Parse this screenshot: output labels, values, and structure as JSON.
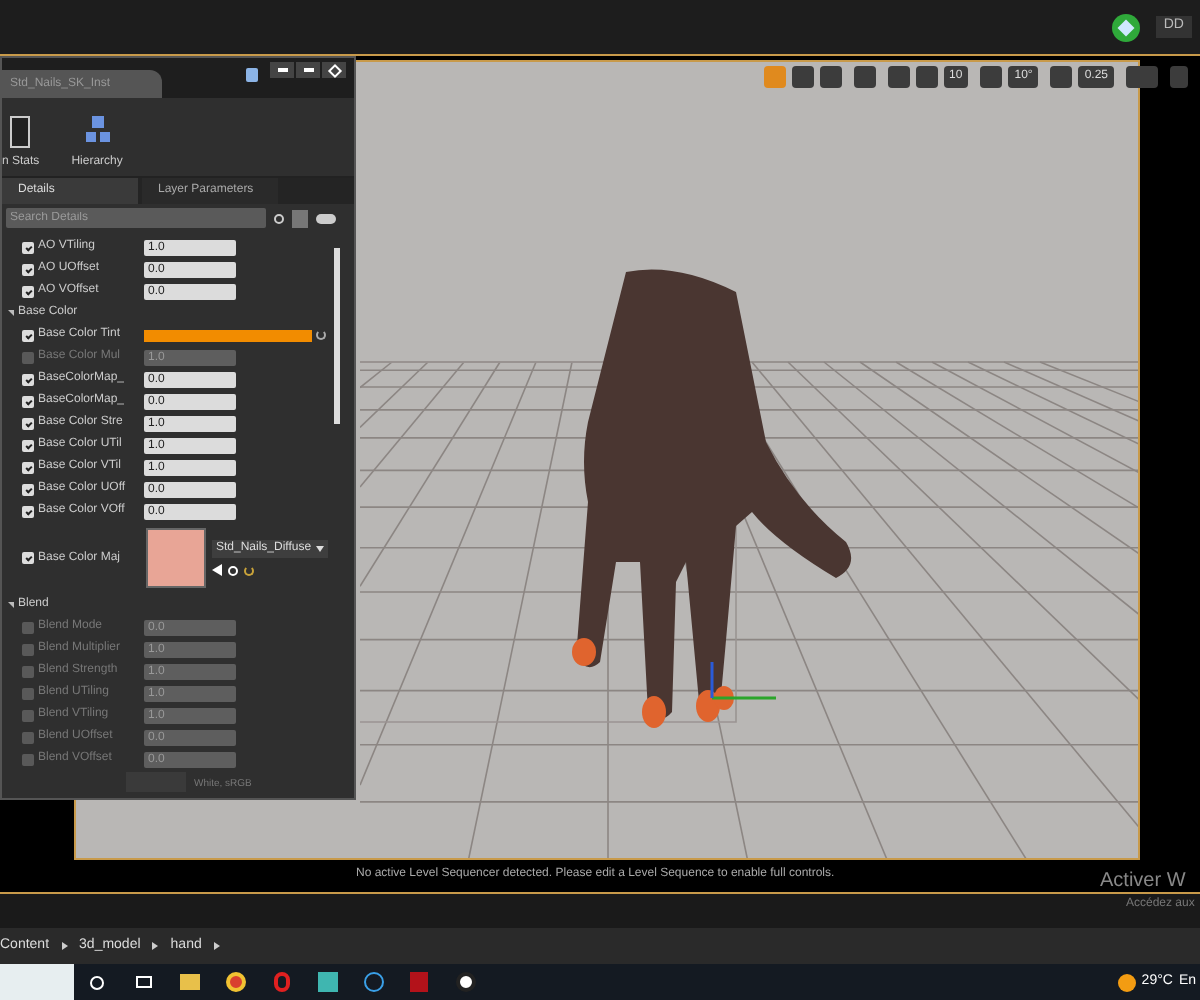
{
  "top_bar": {
    "tab_label": "DD"
  },
  "viewport_toolbar": {
    "grid_snap": "10",
    "rotation_snap": "10°",
    "scale_snap": "0.25"
  },
  "details_window": {
    "title": "Std_Nails_SK_Inst",
    "toolbar": [
      {
        "label": "n Stats"
      },
      {
        "label": "Hierarchy"
      }
    ],
    "tabs": [
      {
        "label": "Details",
        "selected": true
      },
      {
        "label": "Layer Parameters",
        "selected": false
      }
    ],
    "search": {
      "placeholder": "Search Details"
    },
    "rows": [
      {
        "kind": "number",
        "label": "AO VTiling",
        "value": "1.0",
        "checked": true,
        "disabled": false
      },
      {
        "kind": "number",
        "label": "AO UOffset",
        "value": "0.0",
        "checked": true,
        "disabled": false
      },
      {
        "kind": "number",
        "label": "AO VOffset",
        "value": "0.0",
        "checked": true,
        "disabled": false
      },
      {
        "kind": "section",
        "label": "Base Color"
      },
      {
        "kind": "color",
        "label": "Base Color Tint",
        "color": "#f28c00",
        "checked": true,
        "disabled": false
      },
      {
        "kind": "number",
        "label": "Base Color Mul",
        "value": "1.0",
        "checked": false,
        "disabled": true
      },
      {
        "kind": "number",
        "label": "BaseColorMap_",
        "value": "0.0",
        "checked": true,
        "disabled": false
      },
      {
        "kind": "number",
        "label": "BaseColorMap_",
        "value": "0.0",
        "checked": true,
        "disabled": false
      },
      {
        "kind": "number",
        "label": "Base Color Stre",
        "value": "1.0",
        "checked": true,
        "disabled": false
      },
      {
        "kind": "number",
        "label": "Base Color UTil",
        "value": "1.0",
        "checked": true,
        "disabled": false
      },
      {
        "kind": "number",
        "label": "Base Color VTil",
        "value": "1.0",
        "checked": true,
        "disabled": false
      },
      {
        "kind": "number",
        "label": "Base Color UOff",
        "value": "0.0",
        "checked": true,
        "disabled": false
      },
      {
        "kind": "number",
        "label": "Base Color VOff",
        "value": "0.0",
        "checked": true,
        "disabled": false
      },
      {
        "kind": "texture",
        "label": "Base Color Maj",
        "value": "Std_Nails_Diffuse",
        "checked": true,
        "disabled": false
      },
      {
        "kind": "section",
        "label": "Blend"
      },
      {
        "kind": "number",
        "label": "Blend Mode",
        "value": "0.0",
        "checked": false,
        "disabled": true
      },
      {
        "kind": "number",
        "label": "Blend Multiplier",
        "value": "1.0",
        "checked": false,
        "disabled": true
      },
      {
        "kind": "number",
        "label": "Blend Strength",
        "value": "1.0",
        "checked": false,
        "disabled": true
      },
      {
        "kind": "number",
        "label": "Blend UTiling",
        "value": "1.0",
        "checked": false,
        "disabled": true
      },
      {
        "kind": "number",
        "label": "Blend VTiling",
        "value": "1.0",
        "checked": false,
        "disabled": true
      },
      {
        "kind": "number",
        "label": "Blend UOffset",
        "value": "0.0",
        "checked": false,
        "disabled": true
      },
      {
        "kind": "number",
        "label": "Blend VOffset",
        "value": "0.0",
        "checked": false,
        "disabled": true
      }
    ],
    "footer_value": "White, sRGB"
  },
  "viewport_message": "No active Level Sequencer detected. Please edit a Level Sequence to enable full controls.",
  "activation_notice": {
    "title": "Activer W",
    "subtitle": "Accédez aux"
  },
  "breadcrumbs": [
    {
      "label": "Content"
    },
    {
      "label": "3d_model"
    },
    {
      "label": "hand"
    }
  ],
  "taskbar": {
    "temperature": "29°C",
    "tray_text": "En"
  }
}
